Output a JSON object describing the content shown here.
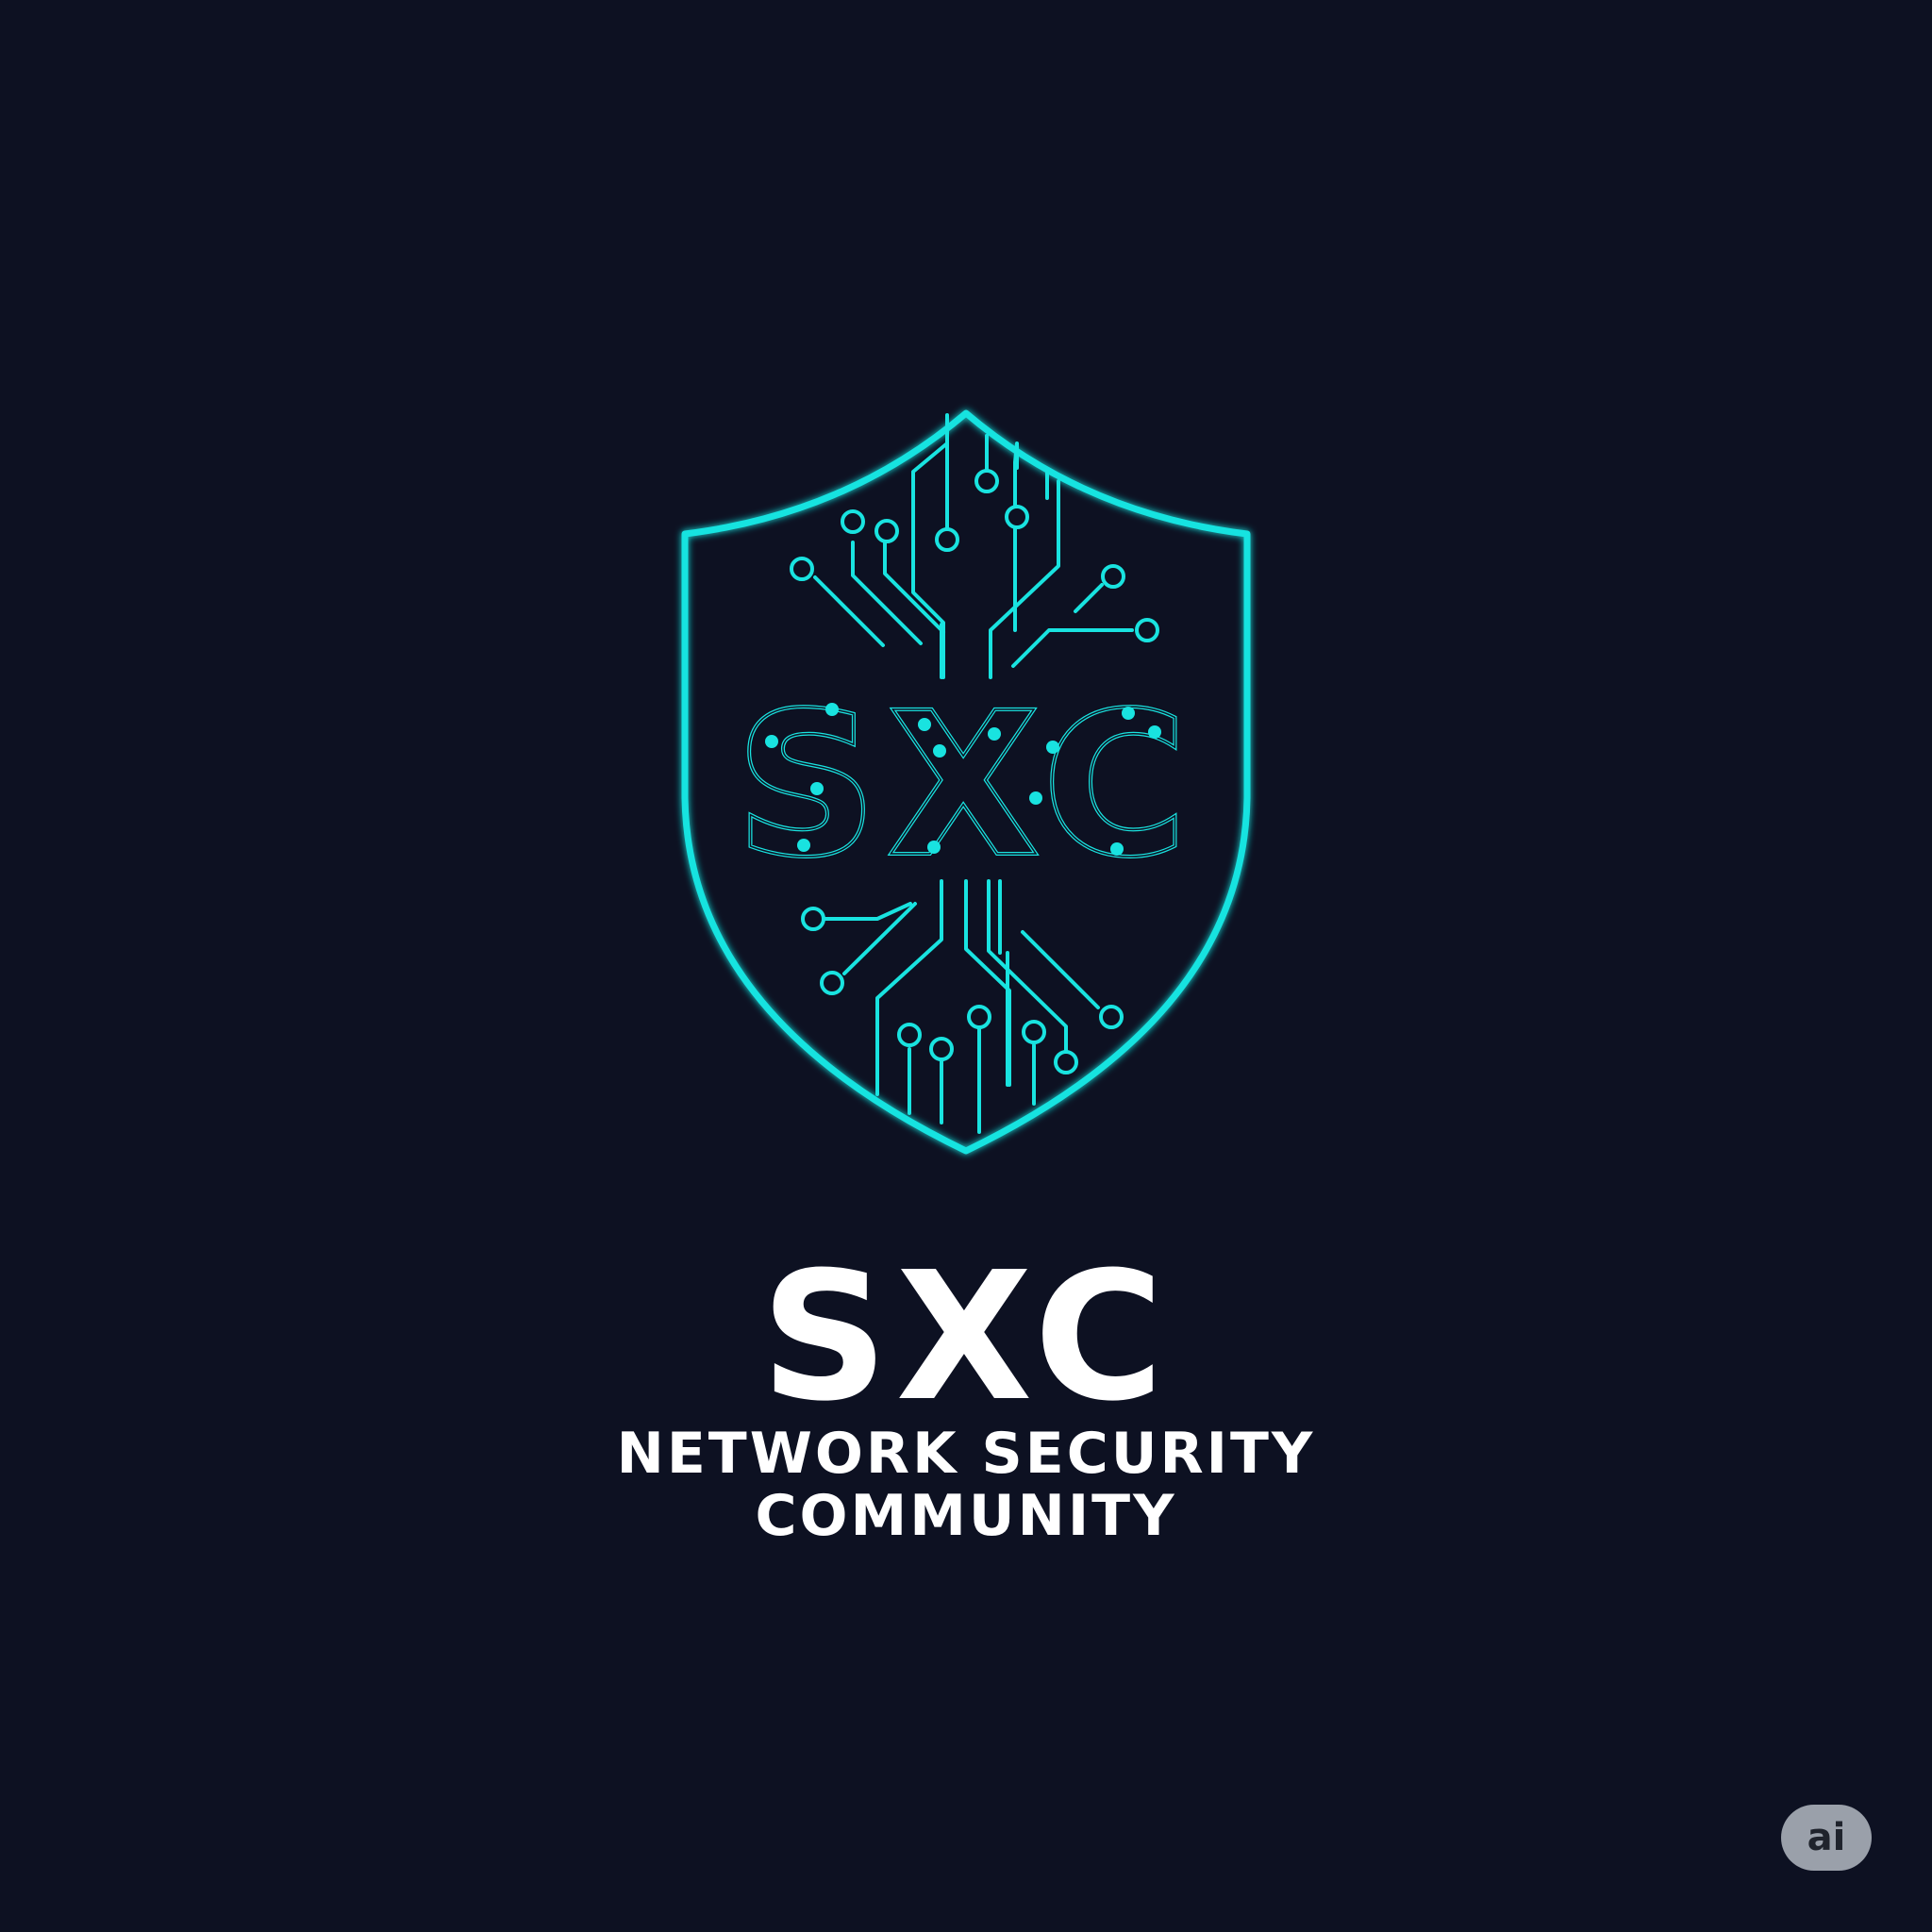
{
  "logo": {
    "shield_monogram": "SXC",
    "accent_color": "#19e3e0",
    "background_color": "#0d1122"
  },
  "brand": {
    "name": "SXC",
    "tagline_line1": "NETWORK SECURITY",
    "tagline_line2": "COMMUNITY"
  },
  "badge": {
    "label": "ai"
  }
}
